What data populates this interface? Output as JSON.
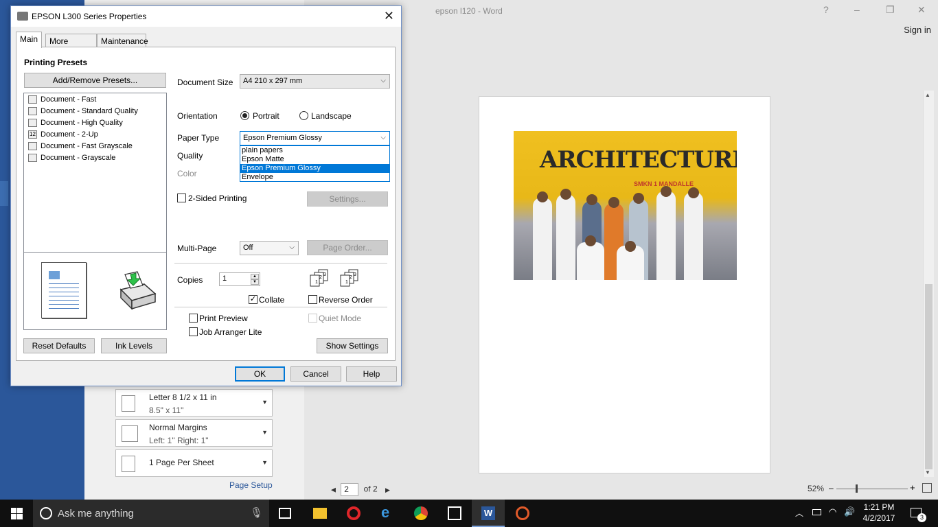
{
  "word": {
    "title": "epson l120 - Word",
    "help": "?",
    "minimize": "–",
    "restore": "❐",
    "close": "✕",
    "sign_in": "Sign in",
    "settings": [
      {
        "line1": "Letter 8 1/2 x 11 in",
        "line2": "8.5\" x 11\""
      },
      {
        "line1": "Normal Margins",
        "line2": "Left:  1\"    Right:  1\""
      },
      {
        "line1": "1 Page Per Sheet",
        "line2": ""
      }
    ],
    "page_setup": "Page Setup",
    "page_nav": {
      "current": "2",
      "of": "of 2"
    },
    "zoom": "52%",
    "photo_banner": "ARCHITECTURE",
    "photo_sub": "SMKN 1 MANDALLE"
  },
  "dialog": {
    "title": "EPSON L300 Series Properties",
    "tabs": [
      "Main",
      "More Options",
      "Maintenance"
    ],
    "presets_heading": "Printing Presets",
    "add_remove": "Add/Remove Presets...",
    "presets": [
      "Document - Fast",
      "Document - Standard Quality",
      "Document - High Quality",
      "Document - 2-Up",
      "Document - Fast Grayscale",
      "Document - Grayscale"
    ],
    "reset_defaults": "Reset Defaults",
    "ink_levels": "Ink Levels",
    "document_size_label": "Document Size",
    "document_size_value": "A4 210 x 297 mm",
    "orientation_label": "Orientation",
    "portrait": "Portrait",
    "landscape": "Landscape",
    "paper_type_label": "Paper Type",
    "paper_type_value": "Epson Premium Glossy",
    "paper_type_options": [
      "plain papers",
      "Epson Matte",
      "Epson Premium Glossy",
      "Envelope"
    ],
    "quality_label": "Quality",
    "color_label": "Color",
    "two_sided": "2-Sided Printing",
    "settings_btn": "Settings...",
    "multi_page_label": "Multi-Page",
    "multi_page_value": "Off",
    "page_order_btn": "Page Order...",
    "copies_label": "Copies",
    "copies_value": "1",
    "collate": "Collate",
    "reverse_order": "Reverse Order",
    "print_preview": "Print Preview",
    "quiet_mode": "Quiet Mode",
    "job_arranger": "Job Arranger Lite",
    "show_settings": "Show Settings",
    "ok": "OK",
    "cancel": "Cancel",
    "help": "Help"
  },
  "taskbar": {
    "search_placeholder": "Ask me anything",
    "time": "1:21 PM",
    "date": "4/2/2017",
    "notifications": "3"
  }
}
